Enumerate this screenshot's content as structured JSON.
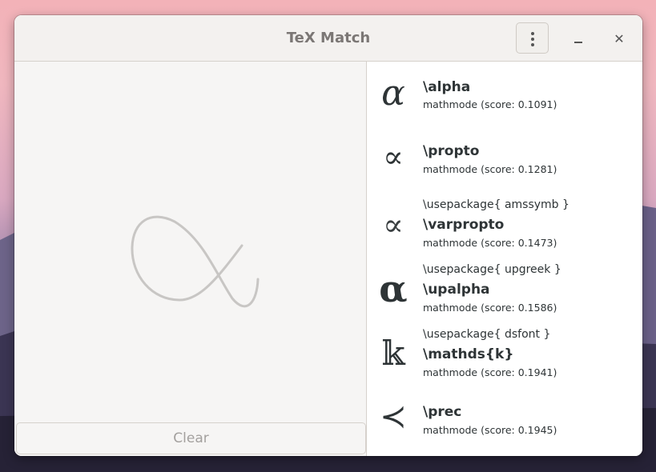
{
  "window": {
    "title": "TeX Match"
  },
  "drawing": {
    "clear_label": "Clear"
  },
  "results": [
    {
      "glyph": "α",
      "package": "",
      "command": "\\alpha",
      "mode": "mathmode (score: 0.1091)"
    },
    {
      "glyph": "∝",
      "package": "",
      "command": "\\propto",
      "mode": "mathmode (score: 0.1281)"
    },
    {
      "glyph": "∝",
      "package": "\\usepackage{ amssymb }",
      "command": "\\varpropto",
      "mode": "mathmode (score: 0.1473)"
    },
    {
      "glyph": "α",
      "package": "\\usepackage{ upgreek }",
      "command": "\\upalpha",
      "mode": "mathmode (score: 0.1586)"
    },
    {
      "glyph": "𝕜",
      "package": "\\usepackage{ dsfont }",
      "command": "\\mathds{k}",
      "mode": "mathmode (score: 0.1941)"
    },
    {
      "glyph": "≺",
      "package": "",
      "command": "\\prec",
      "mode": "mathmode (score: 0.1945)"
    }
  ]
}
